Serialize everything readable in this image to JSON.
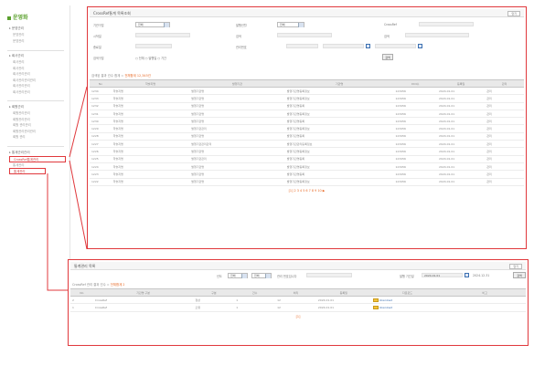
{
  "sidebar": {
    "logo": "운영화",
    "groups": [
      {
        "head": "운영관리",
        "items": [
          "운영관리",
          "운영관리"
        ]
      },
      {
        "head": "회사관리",
        "items": [
          "회사관리",
          "회사관리",
          "회사관리관리",
          "회사관리관리관리",
          "회사관리관리",
          "회사관리관리"
        ]
      },
      {
        "head": "회원관리",
        "items": [
          "회원관리관리",
          "회원관리관리",
          "회원 관리관리",
          "회원관리관리관리",
          "회원 관리"
        ]
      },
      {
        "head": "통계관리관리",
        "items": [
          "CrossRef통계관리",
          "통계관리",
          "통계관리"
        ]
      }
    ]
  },
  "window1": {
    "title": "CrossRef통계 목록조회",
    "close": "닫기",
    "form": {
      "labels": [
        "기관구분",
        "발행년월",
        "CrossRef",
        "시작일",
        "검색",
        "검색",
        "종료일",
        "관리번호",
        "상태",
        "등록일",
        "검색구분",
        "등록일자"
      ],
      "sel1": "전체",
      "sel2": "전체",
      "radio": "○ 전체 ○ 발행일 ○ 기간",
      "search": "검색"
    },
    "count_label": "검색된 결과 건수 합계 = ",
    "count_value": "전체합계 12,345건",
    "columns": [
      "No",
      "학술지명",
      "발행기관",
      "기관명",
      "DOI수",
      "등록일",
      "관리"
    ],
    "rows": [
      [
        "1234",
        "학술지명",
        "발행기관명",
        "발행기관명등록정보",
        "123456",
        "2024.01.01",
        "관리"
      ],
      [
        "1233",
        "학술지명",
        "발행기관명",
        "발행기관명등록정보",
        "123456",
        "2024.01.01",
        "관리"
      ],
      [
        "1232",
        "학술지명",
        "발행기관명",
        "발행기관명등록",
        "123456",
        "2024.01.01",
        "관리"
      ],
      [
        "1231",
        "학술지명",
        "발행기관명",
        "발행기관명등록정보",
        "123456",
        "2024.01.01",
        "관리"
      ],
      [
        "1230",
        "학술지명",
        "발행기관명",
        "발행기관명등록",
        "123456",
        "2024.01.01",
        "관리"
      ],
      [
        "1229",
        "학술지명",
        "발행기관관리",
        "발행기관명등록정보",
        "123456",
        "2024.01.01",
        "관리"
      ],
      [
        "1228",
        "학술지명",
        "발행기관명",
        "발행기관명등록",
        "123456",
        "2024.01.01",
        "관리"
      ],
      [
        "1227",
        "학술지명",
        "발행기관관리관리",
        "발행기관관리등록정보",
        "123456",
        "2024.01.01",
        "관리"
      ],
      [
        "1226",
        "학술지명",
        "발행기관명",
        "발행기관명등록정보",
        "123456",
        "2024.01.01",
        "관리"
      ],
      [
        "1225",
        "학술지명",
        "발행기관관리",
        "발행기관명등록",
        "123456",
        "2024.01.01",
        "관리"
      ],
      [
        "1224",
        "학술지명",
        "발행기관명",
        "발행기관명등록정보",
        "123456",
        "2024.01.01",
        "관리"
      ],
      [
        "1223",
        "학술지명",
        "발행기관명",
        "발행기관명등록",
        "123456",
        "2024.01.01",
        "관리"
      ],
      [
        "1222",
        "학술지명",
        "발행기관명",
        "발행기관명등록정보",
        "123456",
        "2024.01.01",
        "관리"
      ]
    ],
    "pager": "[1] 2 3 4 5 6 7 8 9 10 ▶"
  },
  "window2": {
    "title": "통계관리 목록",
    "close": "닫기",
    "toolbar": {
      "year_label": "년도",
      "sel_year": "전체",
      "sel_month": "전체",
      "query_label": "관리 번호입니다",
      "date_label": "발행 기간일",
      "date_value": "2024.01.01",
      "to_label": "2024.12.31",
      "search": "검색"
    },
    "count_label": "CrossRef 관리 결과 건수 = ",
    "count_value": "전체합계 2",
    "columns": [
      "No",
      "기관명 구분",
      "구분",
      "건수",
      "처리",
      "등록일",
      "다운로드",
      "비고"
    ],
    "rows": [
      [
        "2",
        "CrossRef",
        "정상",
        "1",
        "12",
        "2024.01.01",
        "download",
        ""
      ],
      [
        "1",
        "CrossRef",
        "오류",
        "1",
        "12",
        "2024.01.01",
        "download",
        ""
      ]
    ],
    "pager": "[1]"
  }
}
